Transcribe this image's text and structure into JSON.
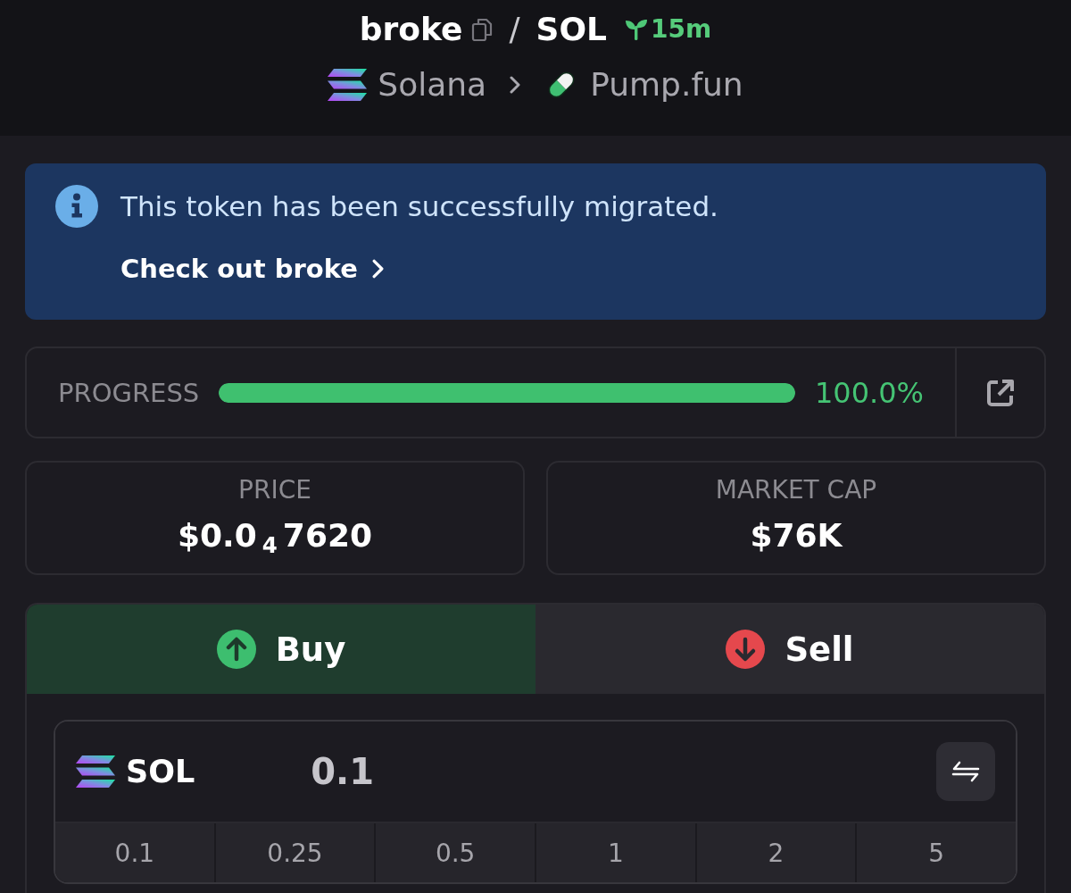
{
  "header": {
    "token": "broke",
    "separator": "/",
    "quote": "SOL",
    "age": "15m",
    "chain": "Solana",
    "platform": "Pump.fun"
  },
  "banner": {
    "message": "This token has been successfully migrated.",
    "link": "Check out broke"
  },
  "progress": {
    "label": "PROGRESS",
    "level": 1.0,
    "reading": "100.0%"
  },
  "stats": [
    {
      "label": "PRICE",
      "value": "$0.0$_{4}$7620"
    },
    {
      "label": "MARKET CAP",
      "value": "$76K"
    }
  ],
  "trade_tabs": [
    {
      "label": "Buy",
      "kind": "buy",
      "selected": true
    },
    {
      "label": "Sell",
      "kind": "sell",
      "selected": false
    }
  ],
  "amount_field": {
    "currency": "SOL",
    "value": "0.1"
  },
  "presets": [
    "0.1",
    "0.25",
    "0.5",
    "1",
    "2",
    "5"
  ]
}
